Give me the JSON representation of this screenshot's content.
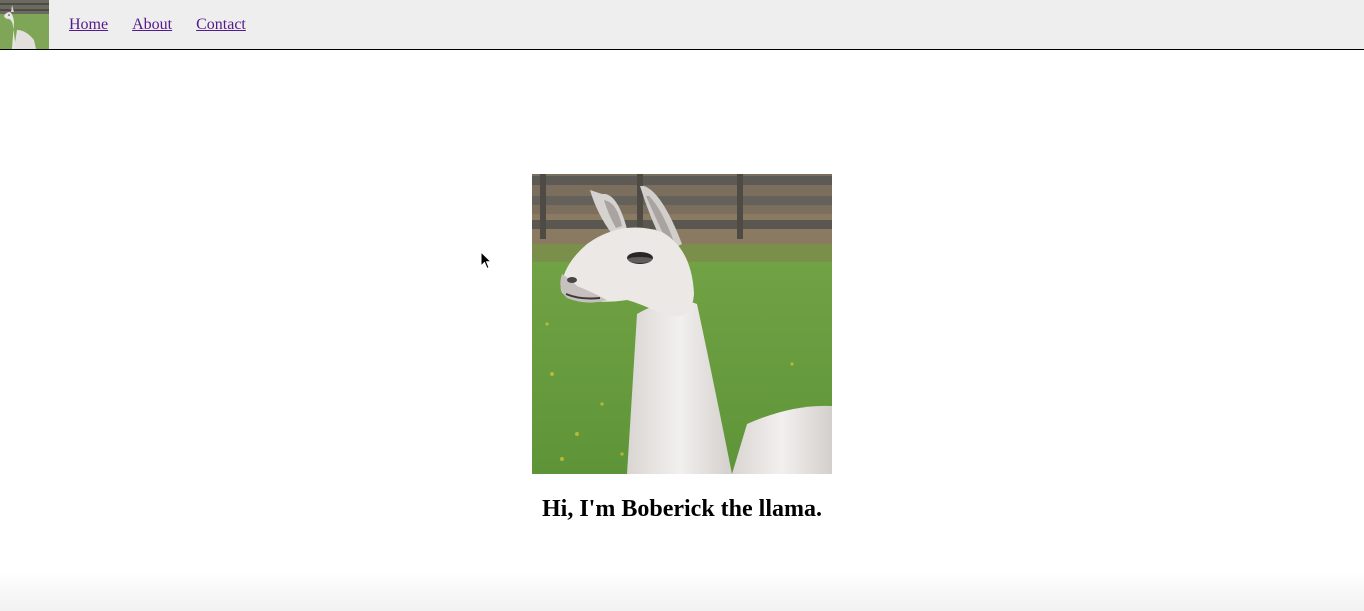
{
  "nav": {
    "logo_icon": "llama-logo-icon",
    "links": [
      {
        "label": "Home"
      },
      {
        "label": "About"
      },
      {
        "label": "Contact"
      }
    ],
    "link_color": "#551a8b",
    "background": "#eeeeee"
  },
  "main": {
    "image_icon": "llama-photo",
    "caption": "Hi, I'm Boberick the llama."
  }
}
